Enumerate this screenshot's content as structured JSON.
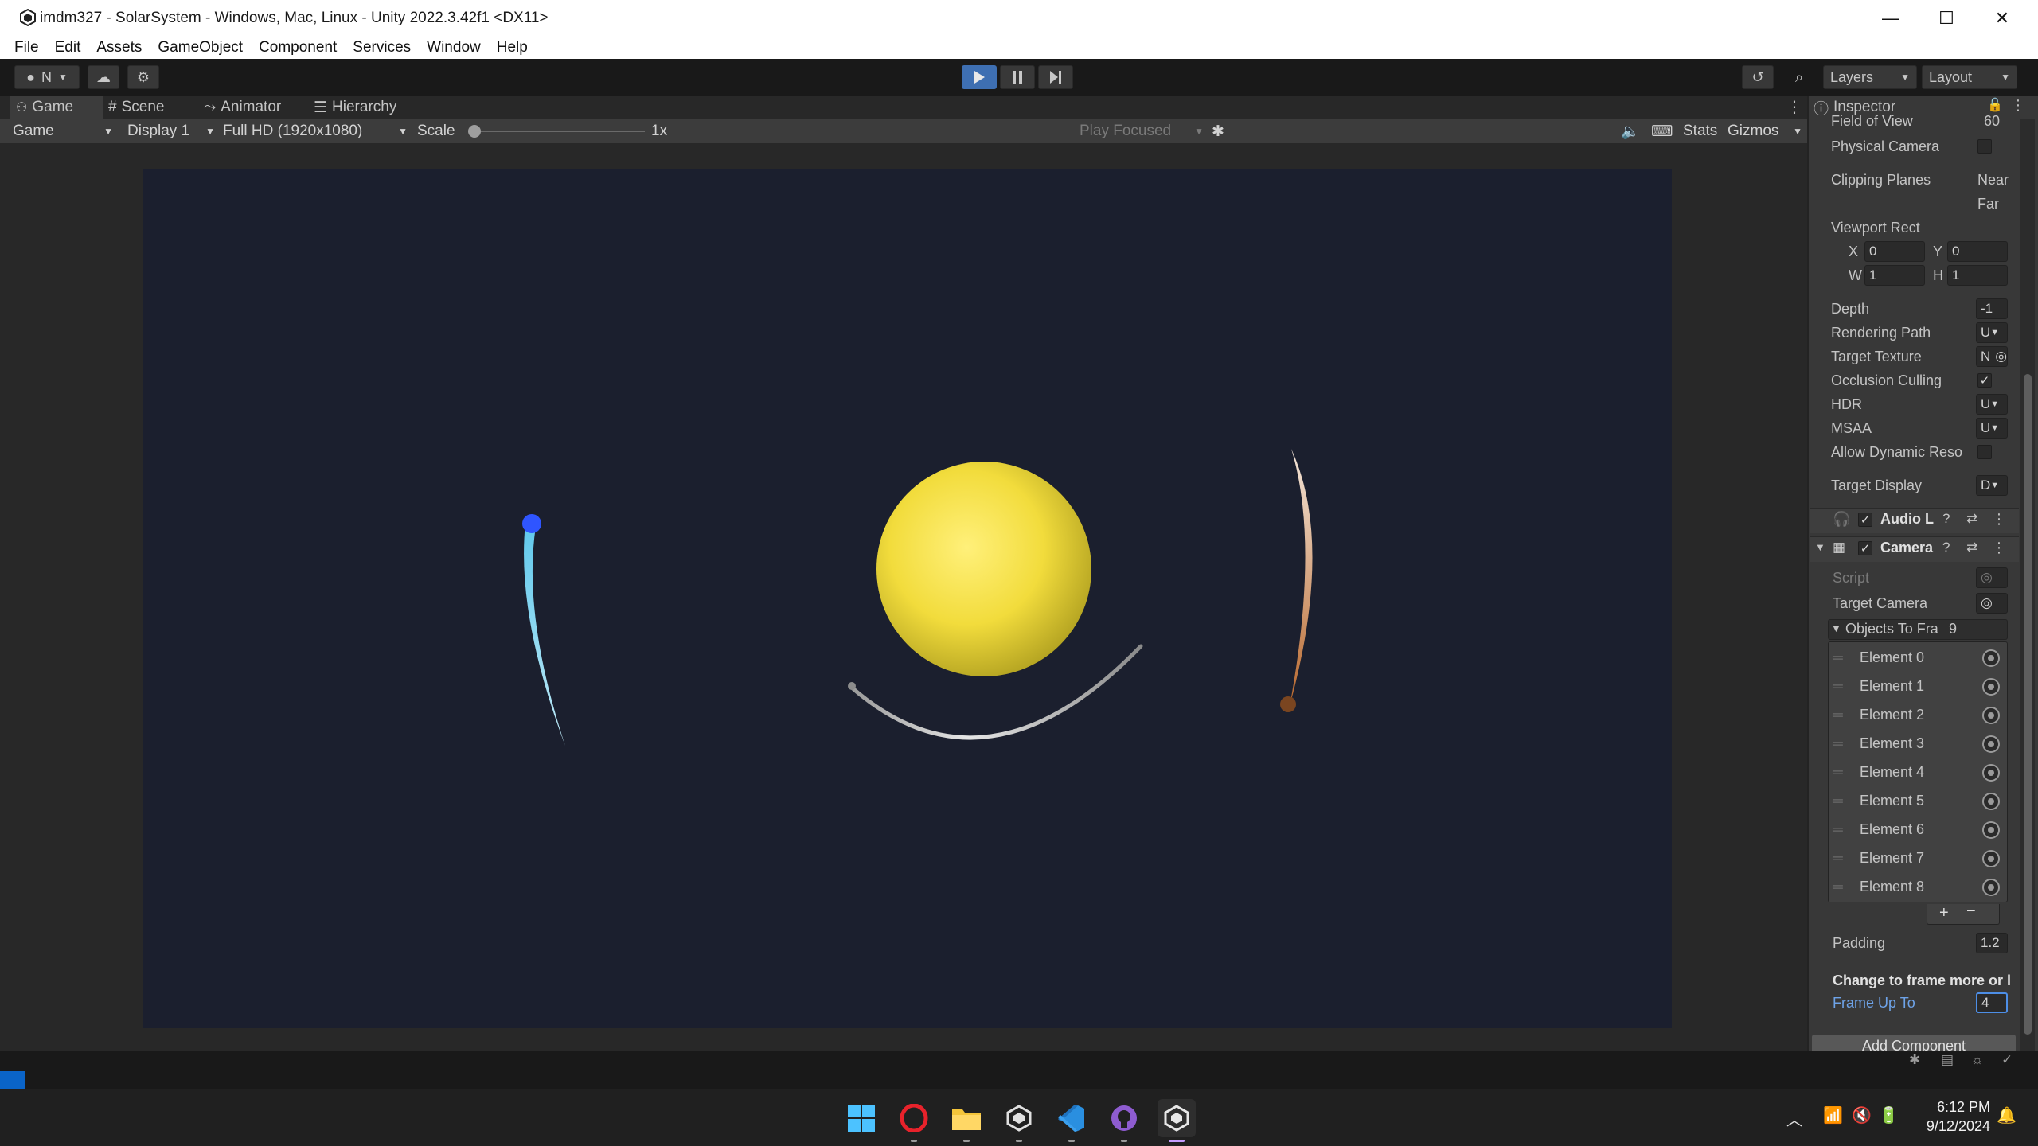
{
  "window": {
    "title": "imdm327 - SolarSystem - Windows, Mac, Linux - Unity 2022.3.42f1 <DX11>",
    "controls": [
      "—",
      "☐",
      "✕"
    ]
  },
  "menu": [
    "File",
    "Edit",
    "Assets",
    "GameObject",
    "Component",
    "Services",
    "Window",
    "Help"
  ],
  "toolbar": {
    "account_label": "N",
    "layers_label": "Layers",
    "layout_label": "Layout"
  },
  "tabs": {
    "game": "Game",
    "scene": "Scene",
    "animator": "Animator",
    "hierarchy": "Hierarchy"
  },
  "game_toolbar": {
    "view_select": "Game",
    "display_select": "Display 1",
    "resolution_select": "Full HD (1920x1080)",
    "scale_label": "Scale",
    "scale_value": "1x",
    "play_mode": "Play Focused",
    "stats": "Stats",
    "gizmos": "Gizmos"
  },
  "scene_objects": {
    "sun_color": "#f2dc3c",
    "blue_planet_color": "#2f55ff",
    "orange_planet_color": "#b8672c",
    "trail_white": "#dcdcdc",
    "trail_cyan": "#7fd2ee"
  },
  "inspector": {
    "tab_title": "Inspector",
    "field_of_view_label": "Field of View",
    "field_of_view_value": "60",
    "physical_camera": "Physical Camera",
    "clipping_planes": "Clipping Planes",
    "near": "Near",
    "far": "Far",
    "viewport_rect": "Viewport Rect",
    "x_label": "X",
    "x_value": "0",
    "y_label": "Y",
    "y_value": "0",
    "w_label": "W",
    "w_value": "1",
    "h_label": "H",
    "h_value": "1",
    "depth_label": "Depth",
    "depth_value": "-1",
    "rendering_path": "Rendering Path",
    "rendering_path_value": "U",
    "target_texture": "Target Texture",
    "target_texture_value": "N",
    "occlusion_culling": "Occlusion Culling",
    "hdr": "HDR",
    "hdr_value": "U",
    "msaa": "MSAA",
    "msaa_value": "U",
    "allow_dynamic": "Allow Dynamic Reso",
    "target_display": "Target Display",
    "target_display_value": "D",
    "audio_component": "Audio L",
    "camera_component": "Camera",
    "script_label": "Script",
    "target_camera": "Target Camera",
    "objects_to_frame": "Objects To Fra",
    "objects_count": "9",
    "elements": [
      "Element 0",
      "Element 1",
      "Element 2",
      "Element 3",
      "Element 4",
      "Element 5",
      "Element 6",
      "Element 7",
      "Element 8"
    ],
    "padding_label": "Padding",
    "padding_value": "1.2",
    "tooltip_text": "Change to frame more or l",
    "frame_up_to_label": "Frame Up To",
    "frame_up_to_value": "4",
    "add_component": "Add Component"
  },
  "taskbar": {
    "time": "6:12 PM",
    "date": "9/12/2024"
  }
}
